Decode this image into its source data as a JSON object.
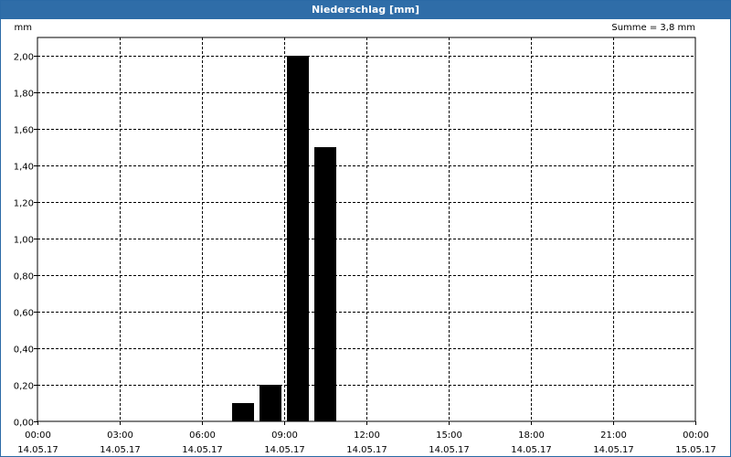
{
  "window": {
    "title": "Niederschlag [mm]"
  },
  "chart_data": {
    "type": "bar",
    "title": "Niederschlag [mm]",
    "ylabel": "mm",
    "annotation": "Summe = 3,8 mm",
    "ylim": [
      0,
      2.1
    ],
    "y_ticks": [
      "0,00",
      "0,20",
      "0,40",
      "0,60",
      "0,80",
      "1,00",
      "1,20",
      "1,40",
      "1,60",
      "1,80",
      "2,00"
    ],
    "y_tick_values": [
      0,
      0.2,
      0.4,
      0.6,
      0.8,
      1.0,
      1.2,
      1.4,
      1.6,
      1.8,
      2.0
    ],
    "x_range_hours": [
      0,
      24
    ],
    "x_ticks": [
      {
        "time": "00:00",
        "date": "14.05.17"
      },
      {
        "time": "03:00",
        "date": "14.05.17"
      },
      {
        "time": "06:00",
        "date": "14.05.17"
      },
      {
        "time": "09:00",
        "date": "14.05.17"
      },
      {
        "time": "12:00",
        "date": "14.05.17"
      },
      {
        "time": "15:00",
        "date": "14.05.17"
      },
      {
        "time": "18:00",
        "date": "14.05.17"
      },
      {
        "time": "21:00",
        "date": "14.05.17"
      },
      {
        "time": "00:00",
        "date": "15.05.17"
      }
    ],
    "x_tick_hours": [
      0,
      3,
      6,
      9,
      12,
      15,
      18,
      21,
      24
    ],
    "bars": [
      {
        "start": "07:00",
        "end": "08:00",
        "value": 0.1
      },
      {
        "start": "08:00",
        "end": "09:00",
        "value": 0.2
      },
      {
        "start": "09:00",
        "end": "10:00",
        "value": 2.0
      },
      {
        "start": "10:00",
        "end": "11:00",
        "value": 1.5
      }
    ],
    "bar_hour_start": [
      7,
      8,
      9,
      10
    ],
    "grid": true,
    "colors": {
      "bar": "#000000",
      "grid": "#000000",
      "titlebar": "#2f6da8",
      "frame": "#2b6aa6"
    }
  }
}
